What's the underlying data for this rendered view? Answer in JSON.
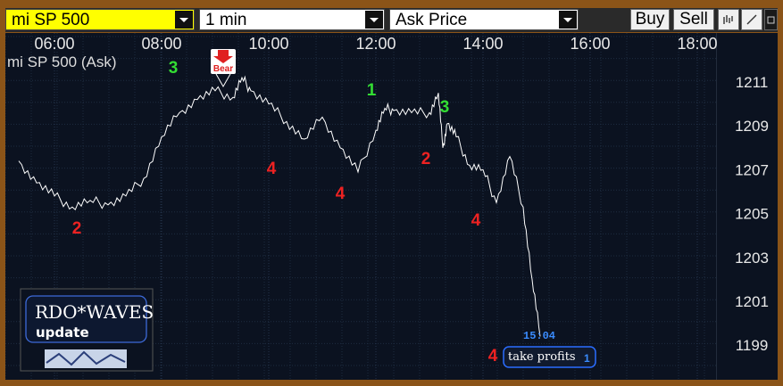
{
  "toolbar": {
    "symbol": "mi SP 500",
    "interval": "1 min",
    "price_type": "Ask Price",
    "buy_label": "Buy",
    "sell_label": "Sell"
  },
  "chart": {
    "title": "mi SP 500 (Ask)",
    "time_labels": [
      "06:00",
      "08:00",
      "10:00",
      "12:00",
      "14:00",
      "16:00",
      "18:00"
    ],
    "price_labels": [
      "1211",
      "1209",
      "1207",
      "1205",
      "1203",
      "1201",
      "1199"
    ],
    "bear_label": "Bear",
    "last_time": "15:04",
    "take_profits": "take profits",
    "take_profits_badge": "1",
    "brand_title": "RDO*WAVES",
    "brand_sub": "update",
    "wave_labels": [
      {
        "text": "3",
        "color": "#33dd33"
      },
      {
        "text": "2",
        "color": "#ee2222"
      },
      {
        "text": "4",
        "color": "#ee2222"
      },
      {
        "text": "4",
        "color": "#ee2222"
      },
      {
        "text": "1",
        "color": "#33dd33"
      },
      {
        "text": "2",
        "color": "#ee2222"
      },
      {
        "text": "3",
        "color": "#33dd33"
      },
      {
        "text": "4",
        "color": "#ee2222"
      },
      {
        "text": "4",
        "color": "#ee2222"
      }
    ]
  },
  "chart_data": {
    "type": "line",
    "title": "mi SP 500 (Ask)",
    "x": [
      "05:20",
      "05:40",
      "06:00",
      "06:20",
      "06:40",
      "07:00",
      "07:20",
      "07:40",
      "08:00",
      "08:20",
      "08:40",
      "09:00",
      "09:20",
      "09:30",
      "09:40",
      "10:00",
      "10:20",
      "10:40",
      "11:00",
      "11:20",
      "11:40",
      "12:00",
      "12:10",
      "12:20",
      "12:40",
      "13:00",
      "13:10",
      "13:15",
      "13:20",
      "13:30",
      "13:45",
      "14:00",
      "14:15",
      "14:30",
      "14:45",
      "14:55",
      "15:04"
    ],
    "series": [
      {
        "values": [
          1207.4,
          1206.4,
          1205.8,
          1205.3,
          1205.6,
          1205.4,
          1205.8,
          1206.6,
          1208.5,
          1209.6,
          1210.2,
          1210.6,
          1210.3,
          1211.2,
          1210.6,
          1210.0,
          1209.2,
          1208.4,
          1209.4,
          1208.0,
          1206.9,
          1208.8,
          1209.8,
          1209.7,
          1209.6,
          1209.6,
          1210.5,
          1208.0,
          1209.1,
          1208.5,
          1207.2,
          1207.0,
          1205.5,
          1207.6,
          1205.3,
          1202.0,
          1199.4
        ]
      }
    ],
    "ylim": [
      1198,
      1213
    ],
    "yticks": [
      1211,
      1209,
      1207,
      1205,
      1203,
      1201,
      1199
    ],
    "xticks": [
      "06:00",
      "08:00",
      "10:00",
      "12:00",
      "14:00",
      "16:00",
      "18:00"
    ],
    "grid": true
  }
}
